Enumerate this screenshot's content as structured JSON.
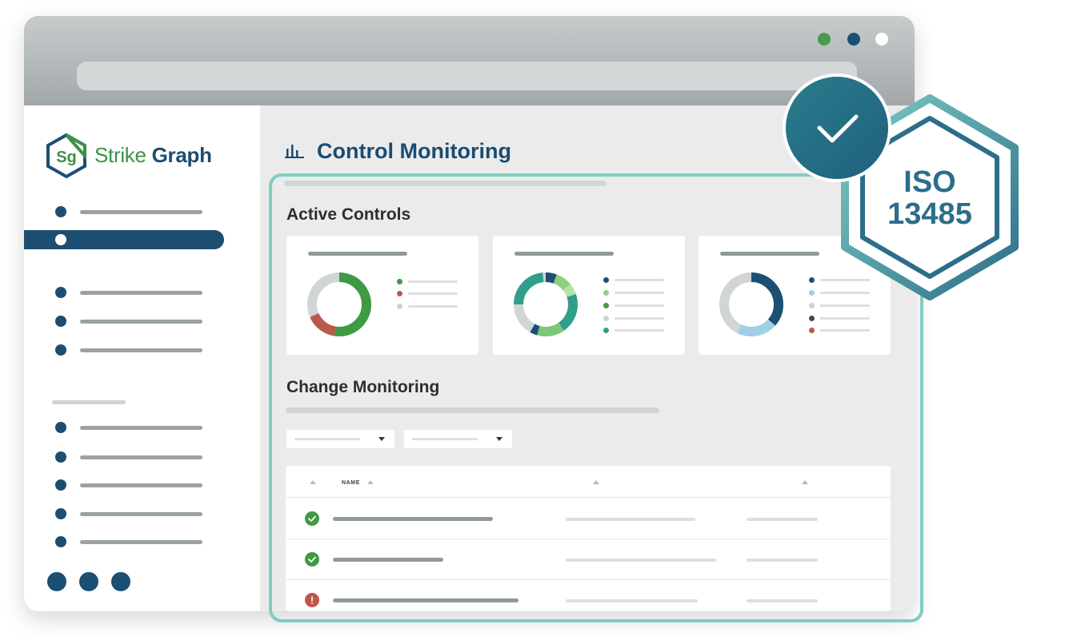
{
  "brand": {
    "logo_mark": "Sg",
    "name_part1": "Strike",
    "name_part2": "Graph",
    "colors": {
      "green": "#3d9146",
      "navy": "#1b4e73",
      "teal": "#7fcdc2"
    }
  },
  "window": {
    "controls": [
      {
        "name": "green-dot",
        "color": "#4a9a4c"
      },
      {
        "name": "navy-dot",
        "color": "#1c4f74"
      },
      {
        "name": "white-dot",
        "color": "#ffffff"
      }
    ]
  },
  "main": {
    "title": "Control Monitoring",
    "title_icon": "bar-chart-icon",
    "active_controls_title": "Active Controls",
    "change_monitoring_title": "Change Monitoring"
  },
  "table": {
    "columns": [
      "",
      "NAME",
      "",
      ""
    ],
    "rows": [
      {
        "status": "ok",
        "status_icon": "check-icon",
        "status_color": "#3f9a44"
      },
      {
        "status": "ok",
        "status_icon": "check-icon",
        "status_color": "#3f9a44"
      },
      {
        "status": "alert",
        "status_icon": "exclamation-icon",
        "status_color": "#c0564a"
      }
    ]
  },
  "badge": {
    "line1": "ISO",
    "line2": "13485",
    "check_icon": "check-icon"
  }
}
